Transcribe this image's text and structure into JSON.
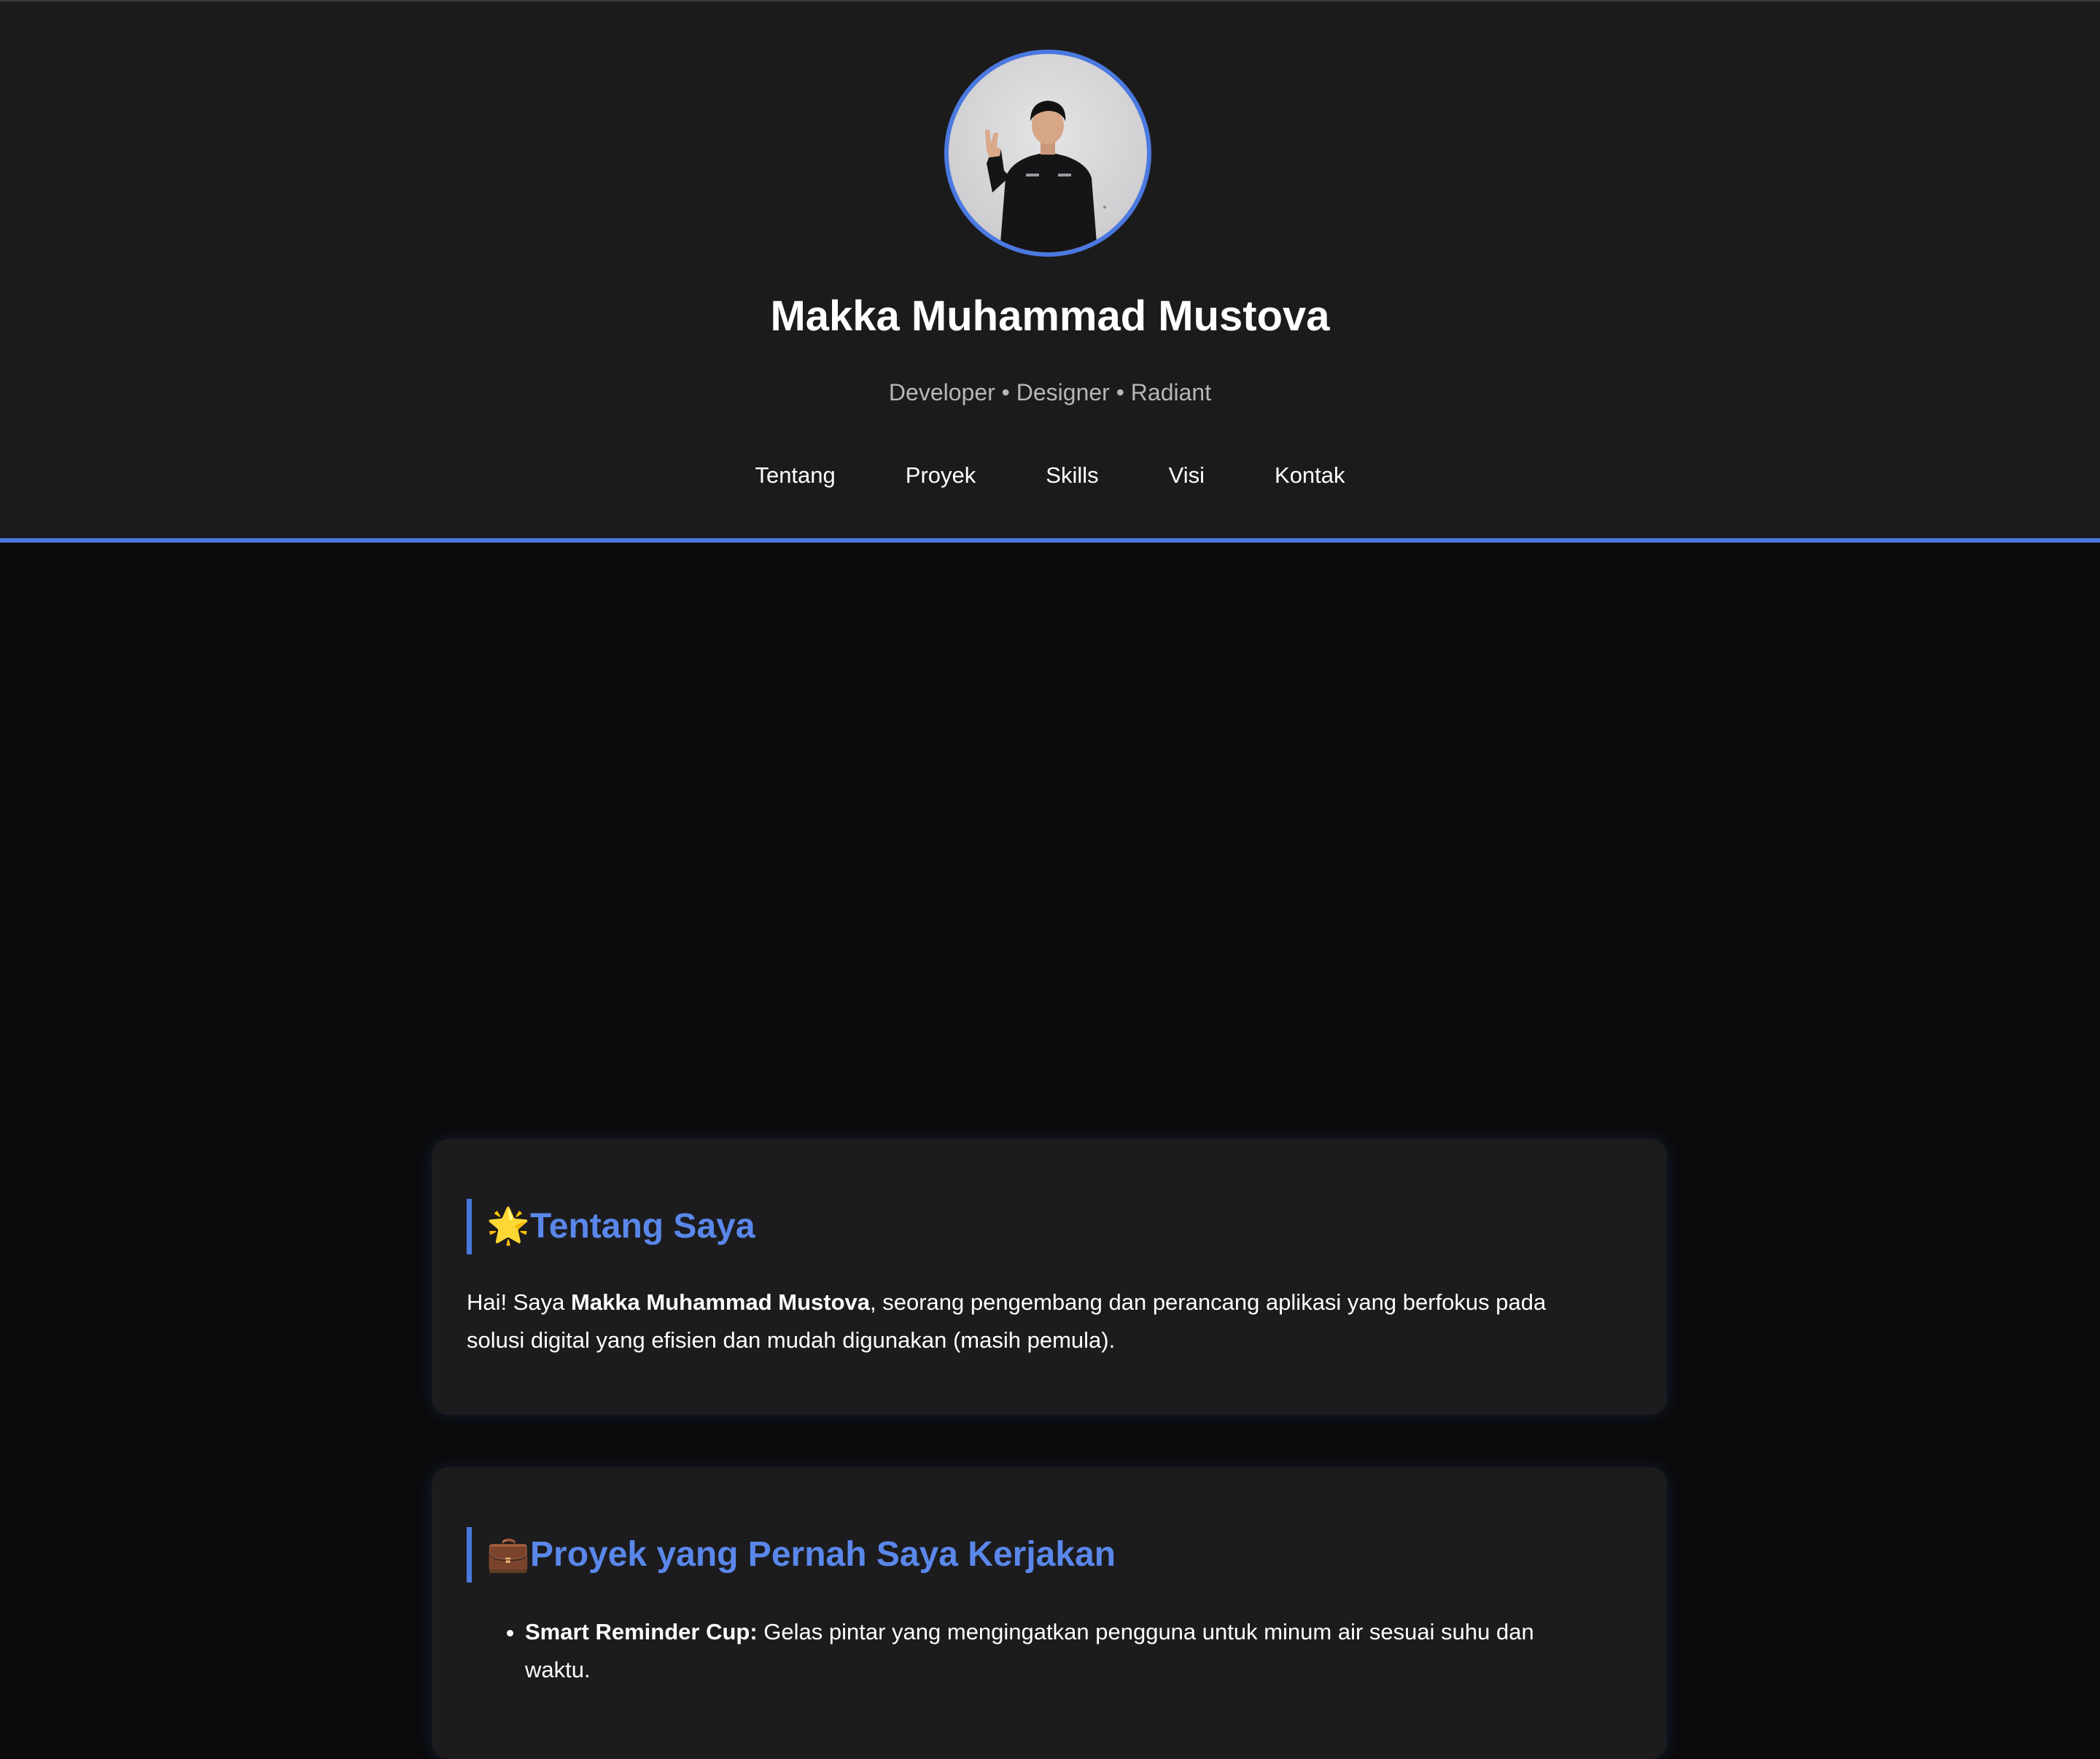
{
  "header": {
    "name": "Makka Muhammad Mustova",
    "tagline": "Developer • Designer • Radiant",
    "nav": [
      "Tentang",
      "Proyek",
      "Skills",
      "Visi",
      "Kontak"
    ]
  },
  "about": {
    "icon": "🌟",
    "title": "Tentang Saya",
    "text_prefix": "Hai! Saya ",
    "text_bold": "Makka Muhammad Mustova",
    "text_suffix": ", seorang pengembang dan perancang aplikasi yang berfokus pada solusi digital yang efisien dan mudah digunakan (masih pemula)."
  },
  "projects": {
    "icon": "💼",
    "title": "Proyek yang Pernah Saya Kerjakan",
    "items": [
      {
        "name": "Smart Reminder Cup:",
        "desc": " Gelas pintar yang mengingatkan pengguna untuk minum air sesuai suhu dan waktu."
      }
    ]
  },
  "colors": {
    "accent": "#4a79e0",
    "header_bg": "#1b1b1c",
    "page_bg": "#0b0b0c",
    "card_bg": "#1c1c1e"
  }
}
